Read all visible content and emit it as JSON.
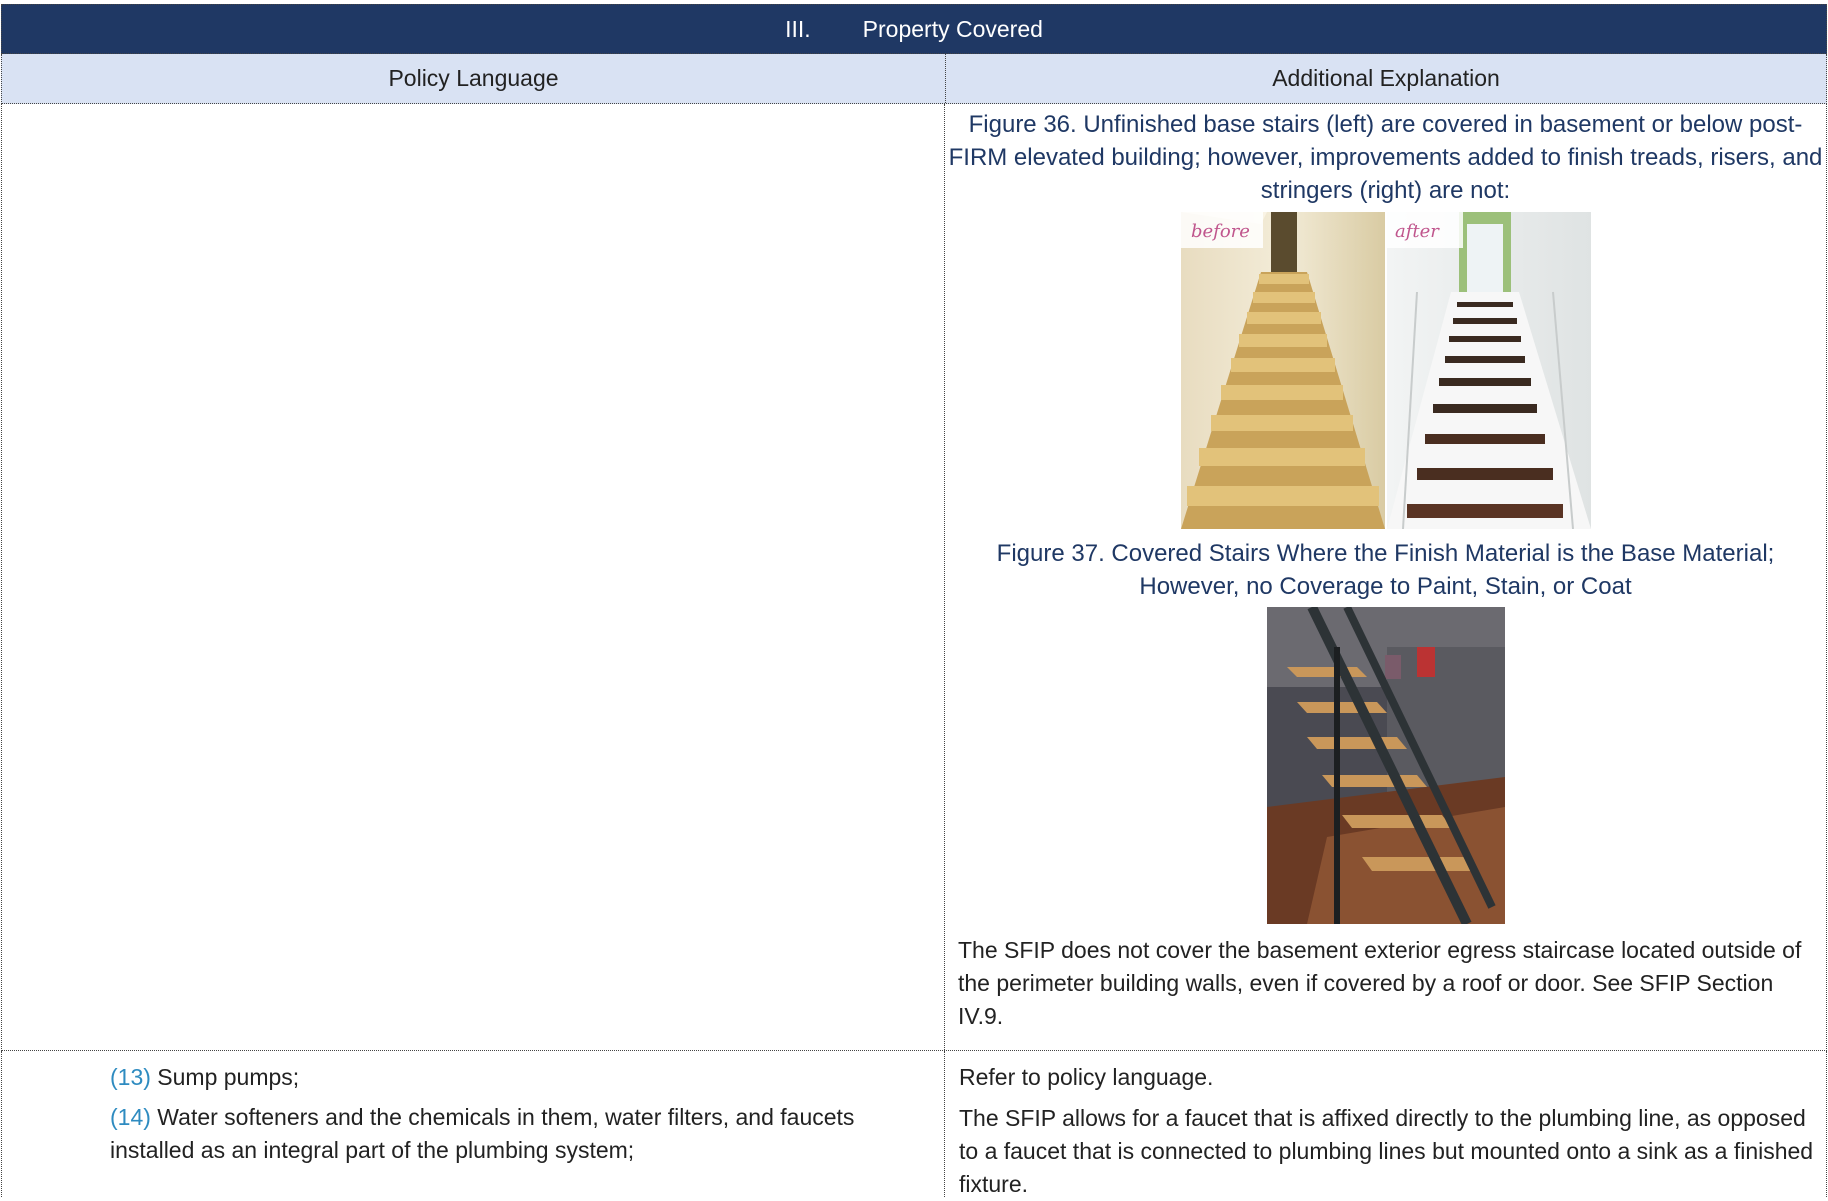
{
  "section": {
    "number": "III.",
    "title": "Property Covered"
  },
  "columns": {
    "left": "Policy Language",
    "right": "Additional Explanation"
  },
  "row1": {
    "figure36_caption": "Figure 36. Unfinished base stairs (left) are covered in basement or below post-FIRM elevated building; however, improvements added to finish treads, risers, and stringers (right) are not:",
    "figure36_labels": {
      "before": "before",
      "after": "after"
    },
    "figure37_caption": "Figure 37. Covered Stairs Where the Finish Material is the Base Material; However, no Coverage to Paint, Stain, or Coat",
    "paragraph": "The SFIP does not cover the basement exterior egress staircase located outside of the perimeter building walls, even if covered by a roof or door. See SFIP Section IV.9."
  },
  "row2": {
    "items": [
      {
        "num": "(13)",
        "text": " Sump pumps;"
      },
      {
        "num": "(14)",
        "text": " Water softeners and the chemicals in them, water filters, and faucets installed as an integral part of the plumbing system;"
      }
    ],
    "explanations": [
      "Refer to policy language.",
      "The SFIP allows for a faucet that is affixed directly to the plumbing line, as opposed to a faucet that is connected to plumbing lines but mounted onto a sink as a finished fixture."
    ]
  },
  "colors": {
    "banner": "#1f3864",
    "header": "#d9e2f3",
    "caption": "#1f3864",
    "item_number": "#2e8bc0"
  }
}
